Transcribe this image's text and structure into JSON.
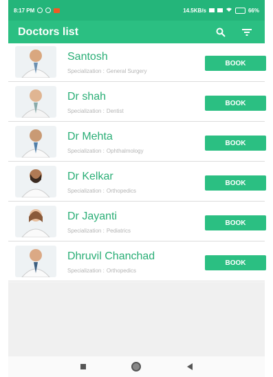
{
  "status_bar": {
    "time": "8:17 PM",
    "speed": "14.5KB/s",
    "battery": "66%"
  },
  "app_bar": {
    "title": "Doctors list",
    "icons": [
      "search-icon",
      "filter-icon"
    ]
  },
  "doctors": [
    {
      "name": "Santosh",
      "spec_label": "Specialization :",
      "specialization": "General Surgery",
      "book_label": "BOOK"
    },
    {
      "name": "Dr shah",
      "spec_label": "Specialization :",
      "specialization": "Dentist",
      "book_label": "BOOK"
    },
    {
      "name": "Dr Mehta",
      "spec_label": "Specialization :",
      "specialization": "Ophthalmology",
      "book_label": "BOOK"
    },
    {
      "name": "Dr Kelkar",
      "spec_label": "Specialization :",
      "specialization": "Orthopedics",
      "book_label": "BOOK"
    },
    {
      "name": "Dr Jayanti",
      "spec_label": "Specialization :",
      "specialization": "Pediatrics",
      "book_label": "BOOK"
    },
    {
      "name": "Dhruvil Chanchad",
      "spec_label": "Specialization :",
      "specialization": "Orthopedics",
      "book_label": "BOOK"
    }
  ],
  "nav_bar": {
    "icons": [
      "recents-icon",
      "home-icon",
      "back-icon"
    ]
  },
  "colors": {
    "accent": "#2bbf82",
    "status_bar": "#24b57a",
    "name_text": "#2aae76",
    "spec_text": "#b4b4b4"
  }
}
